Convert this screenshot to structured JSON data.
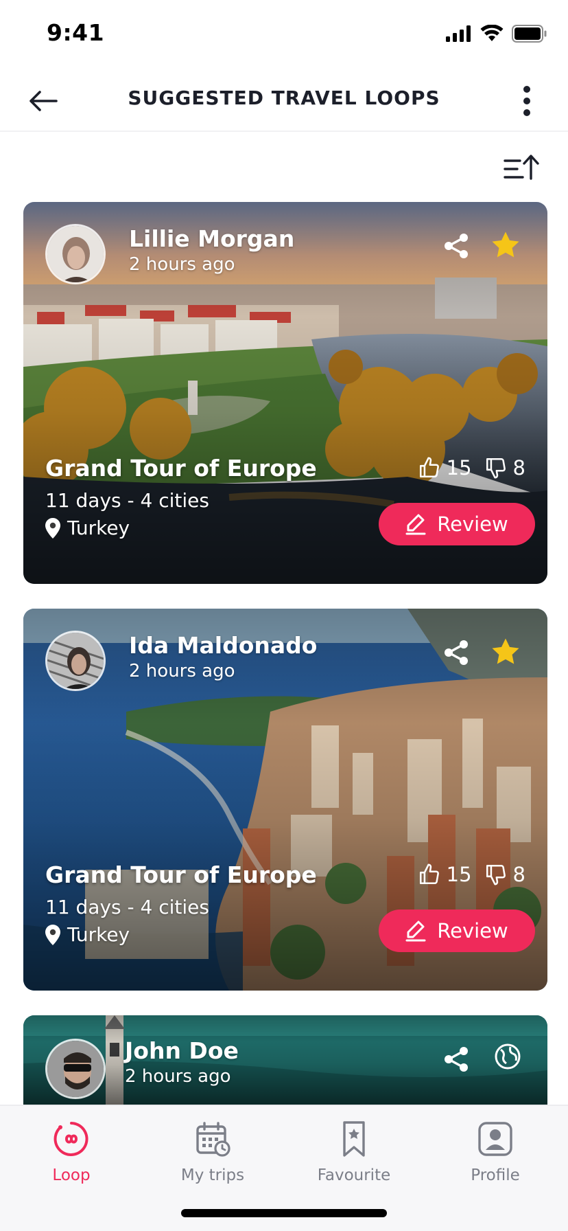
{
  "status_bar": {
    "time": "9:41"
  },
  "header": {
    "title": "SUGGESTED TRAVEL LOOPS"
  },
  "cards": [
    {
      "author": "Lillie Morgan",
      "time_ago": "2 hours ago",
      "title": "Grand Tour of Europe",
      "meta": "11 days - 4 cities",
      "location": "Turkey",
      "likes": "15",
      "dislikes": "8",
      "review_label": "Review",
      "favourite": true
    },
    {
      "author": "Ida Maldonado",
      "time_ago": "2 hours ago",
      "title": "Grand Tour of Europe",
      "meta": "11 days - 4 cities",
      "location": "Turkey",
      "likes": "15",
      "dislikes": "8",
      "review_label": "Review",
      "favourite": true
    },
    {
      "author": "John Doe",
      "time_ago": "2 hours ago"
    }
  ],
  "tab_bar": {
    "tabs": [
      {
        "label": "Loop",
        "icon": "loop-icon",
        "active": true
      },
      {
        "label": "My trips",
        "icon": "calendar-icon",
        "active": false
      },
      {
        "label": "Favourite",
        "icon": "bookmark-icon",
        "active": false
      },
      {
        "label": "Profile",
        "icon": "profile-icon",
        "active": false
      }
    ]
  },
  "colors": {
    "accent": "#ef2a5a",
    "star": "#f5c518",
    "header_text": "#1c1f2a",
    "tab_inactive": "#7b7e88"
  }
}
